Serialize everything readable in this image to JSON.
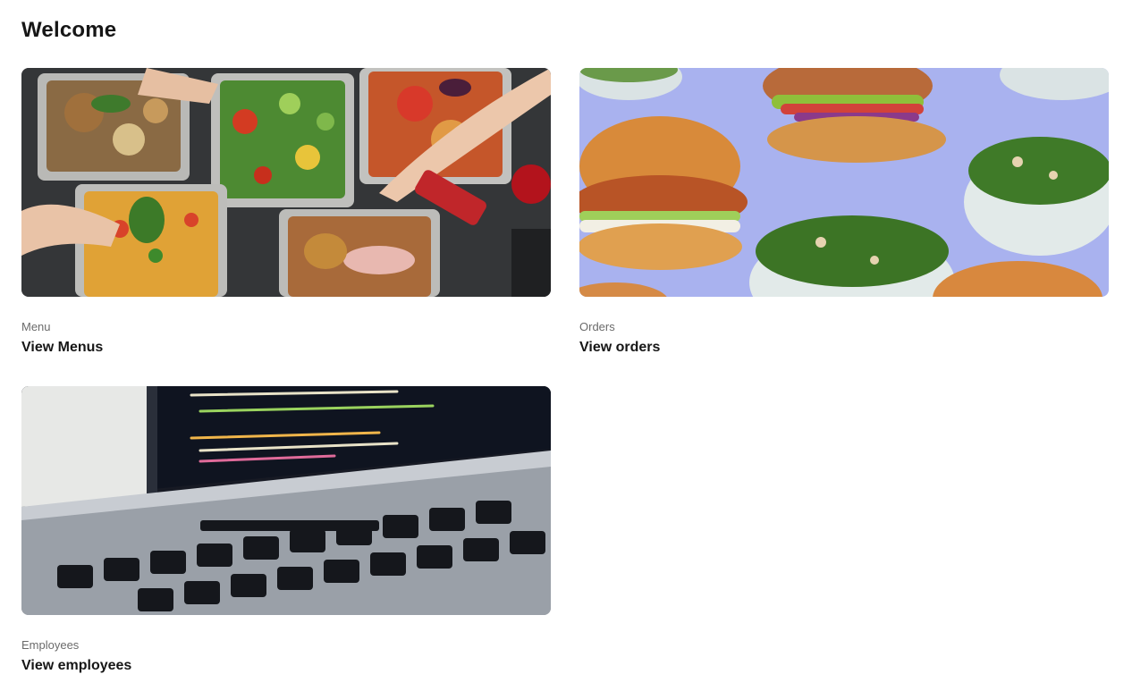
{
  "page": {
    "title": "Welcome"
  },
  "cards": [
    {
      "eyebrow": "Menu",
      "title": "View Menus",
      "image": "meal-prep-trays-photo"
    },
    {
      "eyebrow": "Orders",
      "title": "View orders",
      "image": "burgers-and-salads-photo"
    },
    {
      "eyebrow": "Employees",
      "title": "View employees",
      "image": "laptop-keyboard-code-photo"
    }
  ],
  "colors": {
    "text_primary": "#161616",
    "text_secondary": "#6b6b6b",
    "orders_background": "#a9b2ef"
  }
}
